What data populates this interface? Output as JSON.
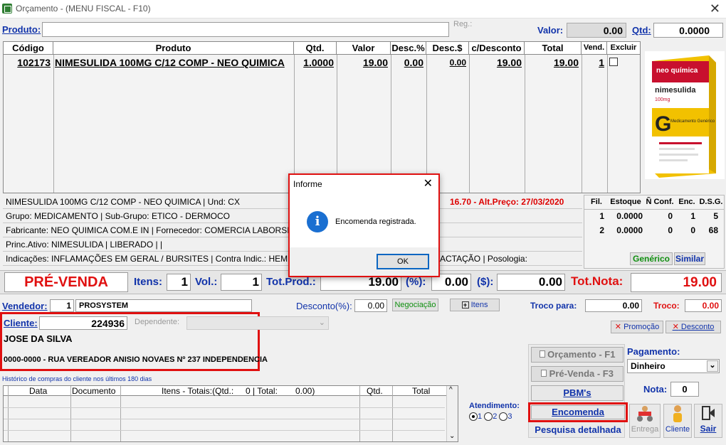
{
  "window": {
    "title": "Orçamento - (MENU FISCAL - F10)"
  },
  "search": {
    "produto_label": "Produto:",
    "reg_label": "Reg.:",
    "valor_label": "Valor:",
    "valor": "0.00",
    "qtd_label": "Qtd:",
    "qtd": "0.0000"
  },
  "grid": {
    "headers": [
      "Código",
      "Produto",
      "Qtd.",
      "Valor",
      "Desc.%",
      "Desc.$",
      "c/Desconto",
      "Total",
      "Vend.",
      "Excluir"
    ],
    "rows": [
      {
        "codigo": "102173",
        "produto": "NIMESULIDA 100MG C/12 COMP - NEO QUIMICA",
        "qtd": "1.0000",
        "valor": "19.00",
        "desc_pct": "0.00",
        "desc_val": "0.00",
        "c_desconto": "19.00",
        "total": "19.00",
        "vend": "1"
      }
    ]
  },
  "product_image": {
    "brand": "neo química",
    "name": "nimesulida",
    "dose": "100mg",
    "generic": "Medicamento Genérico",
    "letter": "G"
  },
  "info": {
    "line1": "NIMESULIDA 100MG C/12 COMP - NEO QUIMICA | Und: CX",
    "price_alert": "16.70 - Alt.Preço: 27/03/2020",
    "line2": "Grupo: MEDICAMENTO | Sub-Grupo: ETICO - DERMOCO",
    "line3": "Fabricante: NEO QUIMICA COM.E IN | Fornecedor: COMERCIA LABORSI",
    "line4": "Princ.Ativo: NIMESULIDA | LIBERADO | |",
    "line5a": "Indicações: INFLAMAÇÕES EM GERAL / BURSITES | Contra Indic.: HEM",
    "line5b": "ACTAÇÃO | Posologia:",
    "generico_btn": "Genérico",
    "similar_btn": "Similar"
  },
  "stock": {
    "headers": [
      "Fil.",
      "Estoque",
      "Ñ Conf.",
      "Enc.",
      "D.S.G."
    ],
    "rows": [
      {
        "fil": "1",
        "estoque": "0.0000",
        "nconf": "0",
        "enc": "1",
        "dsg": "5"
      },
      {
        "fil": "2",
        "estoque": "0.0000",
        "nconf": "0",
        "enc": "0",
        "dsg": "68"
      }
    ]
  },
  "totals": {
    "mode": "PRÉ-VENDA",
    "itens_label": "Itens:",
    "itens": "1",
    "vol_label": "Vol.:",
    "vol": "1",
    "totprod_label": "Tot.Prod.:",
    "totprod": "19.00",
    "pct_label": "(%):",
    "pct": "0.00",
    "dollar_label": "($):",
    "dollar": "0.00",
    "totnota_label": "Tot.Nota:",
    "totnota": "19.00"
  },
  "sale": {
    "vendedor_label": "Vendedor:",
    "vendedor_id": "1",
    "vendedor_name": "PROSYSTEM",
    "desconto_label": "Desconto(%):",
    "desconto": "0.00",
    "negociacao_btn": "Negociação",
    "itens_btn": "Itens",
    "troco_para_label": "Troco para:",
    "troco_para": "0.00",
    "troco_label": "Troco:",
    "troco": "0.00",
    "promocao_btn": "Promoção",
    "desconto_btn": "Desconto"
  },
  "client": {
    "label": "Cliente:",
    "id": "224936",
    "dependente_label": "Dependente:",
    "name": "JOSE DA SILVA",
    "address": "0000-0000 - RUA VEREADOR ANISIO NOVAES Nº 237   INDEPENDENCIA"
  },
  "history": {
    "title": "Histórico de compras do cliente nos últimos 180 dias",
    "headers": [
      "Data",
      "Documento",
      "Itens - Totais:(Qtd.:",
      "0 | Total:",
      "0.00)",
      "Qtd.",
      "Total"
    ]
  },
  "atendimento": {
    "label": "Atendimento:",
    "options": [
      "1",
      "2",
      "3"
    ]
  },
  "actions": {
    "orcamento": "Orçamento - F1",
    "prevenda": "Pré-Venda - F3",
    "pbms": "PBM's",
    "encomenda": "Encomenda",
    "pesquisa": "Pesquisa detalhada",
    "entrega": "Entrega",
    "cliente": "Cliente",
    "sair": "Sair"
  },
  "payment": {
    "label": "Pagamento:",
    "value": "Dinheiro",
    "nota_label": "Nota:",
    "nota": "0"
  },
  "dialog": {
    "title": "Informe",
    "message": "Encomenda registrada.",
    "ok": "OK"
  },
  "colors": {
    "accent_blue": "#1133aa",
    "alert_red": "#e01010",
    "generic_green": "#109010"
  }
}
